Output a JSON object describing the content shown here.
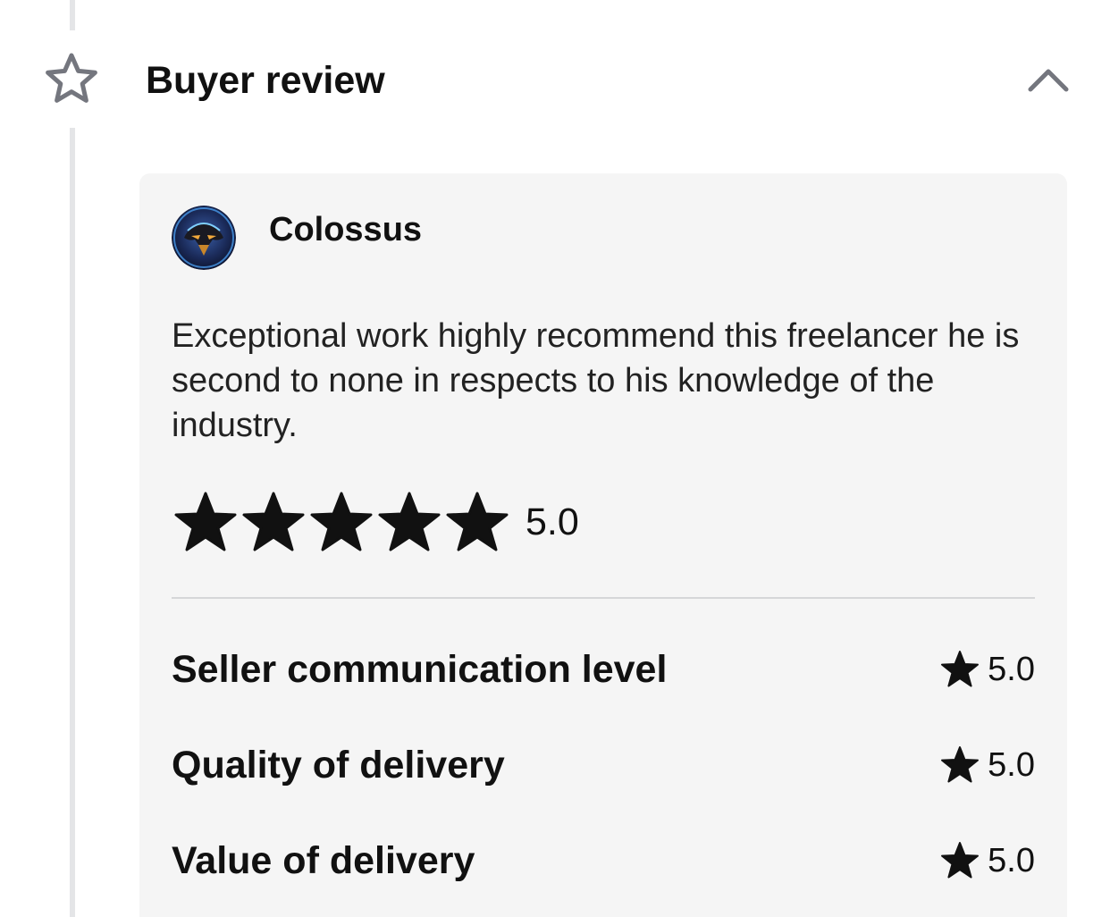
{
  "section": {
    "title": "Buyer review",
    "icon": "star-outline-icon",
    "toggle_icon": "chevron-up-icon"
  },
  "review": {
    "reviewer_name": "Colossus",
    "text": "Exceptional work highly recommend this freelancer he is second to none in respects to his knowledge of the industry.",
    "stars": 5,
    "overall_score": "5.0",
    "metrics": [
      {
        "label": "Seller communication level",
        "score": "5.0"
      },
      {
        "label": "Quality of delivery",
        "score": "5.0"
      },
      {
        "label": "Value of delivery",
        "score": "5.0"
      }
    ]
  },
  "colors": {
    "card_background": "#f5f5f5",
    "star_fill": "#111111",
    "timeline": "#e4e5e7"
  }
}
